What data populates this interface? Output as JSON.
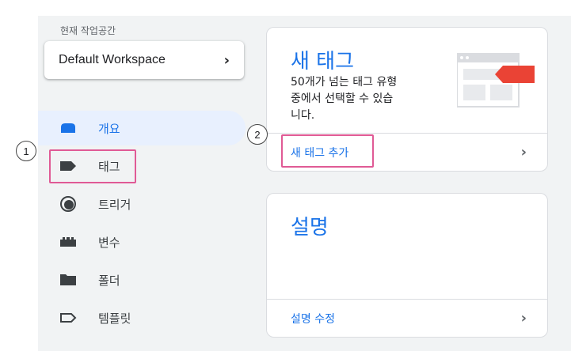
{
  "workspace": {
    "label": "현재 작업공간",
    "name": "Default Workspace",
    "chevron": "›"
  },
  "sidebar": {
    "items": [
      {
        "label": "개요",
        "icon": "overview-icon",
        "active": true
      },
      {
        "label": "태그",
        "icon": "tag-icon",
        "active": false
      },
      {
        "label": "트리거",
        "icon": "trigger-icon",
        "active": false
      },
      {
        "label": "변수",
        "icon": "variable-icon",
        "active": false
      },
      {
        "label": "폴더",
        "icon": "folder-icon",
        "active": false
      },
      {
        "label": "템플릿",
        "icon": "template-icon",
        "active": false
      }
    ]
  },
  "callouts": {
    "one": "1",
    "two": "2"
  },
  "new_tag_card": {
    "title": "새 태그",
    "description_line1": "50개가 넘는 태그 유형",
    "description_line2": "중에서 선택할 수 있습",
    "description_line3": "니다.",
    "link": "새 태그 추가",
    "chevron": "›"
  },
  "description_card": {
    "title": "설명",
    "link": "설명 수정",
    "chevron": "›"
  },
  "colors": {
    "accent": "#1a73e8",
    "active_bg": "#e8f0fe",
    "highlight": "#e05a95",
    "workspace_bg": "#f1f3f4",
    "tag_red": "#ea4335"
  }
}
